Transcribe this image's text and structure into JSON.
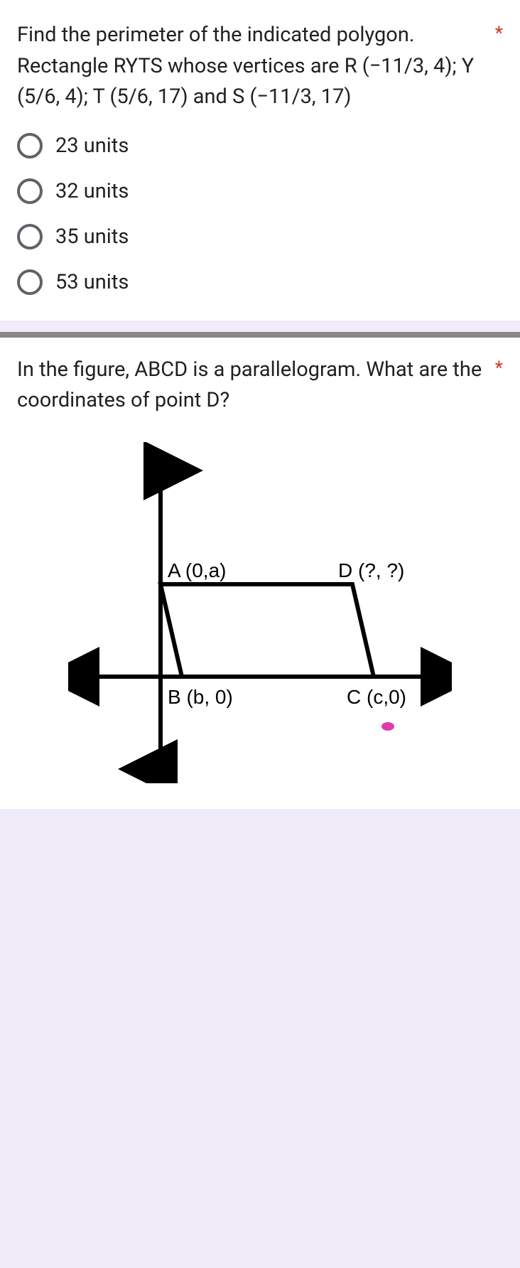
{
  "q1": {
    "text": "Find the perimeter  of the indicated polygon. Rectangle RYTS whose vertices are R (−11/3, 4); Y (5/6, 4); T (5/6, 17) and S (−11/3, 17)",
    "required_mark": "*",
    "options": [
      {
        "label": "23 units"
      },
      {
        "label": "32 units"
      },
      {
        "label": "35 units"
      },
      {
        "label": "53 units"
      }
    ]
  },
  "q2": {
    "text": "In the figure, ABCD is a parallelogram. What are the coordinates of point D?",
    "required_mark": "*",
    "labels": {
      "A": "A (0,a)",
      "B": "B (b, 0)",
      "C": "C (c,0)",
      "D": "D (?, ?)"
    }
  }
}
